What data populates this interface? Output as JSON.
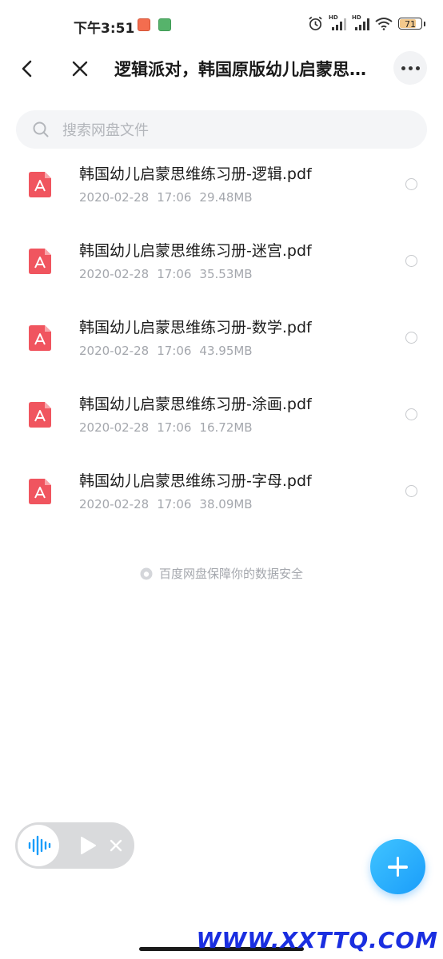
{
  "status_bar": {
    "time": "下午3:51",
    "network_label": "HD",
    "battery": "71",
    "icons": [
      "alarm-icon",
      "signal-icon",
      "signal-icon",
      "wifi-icon",
      "battery-icon"
    ]
  },
  "header": {
    "title": "逻辑派对，韩国原版幼儿启蒙思维练习册",
    "back_icon": "chevron-left-icon",
    "close_icon": "close-icon",
    "more_icon": "more-icon"
  },
  "search": {
    "placeholder": "搜索网盘文件"
  },
  "files": [
    {
      "name": "韩国幼儿启蒙思维练习册-逻辑.pdf",
      "date": "2020-02-28",
      "time": "17:06",
      "size": "29.48MB",
      "icon": "pdf-icon"
    },
    {
      "name": "韩国幼儿启蒙思维练习册-迷宫.pdf",
      "date": "2020-02-28",
      "time": "17:06",
      "size": "35.53MB",
      "icon": "pdf-icon"
    },
    {
      "name": "韩国幼儿启蒙思维练习册-数学.pdf",
      "date": "2020-02-28",
      "time": "17:06",
      "size": "43.95MB",
      "icon": "pdf-icon"
    },
    {
      "name": "韩国幼儿启蒙思维练习册-涂画.pdf",
      "date": "2020-02-28",
      "time": "17:06",
      "size": "16.72MB",
      "icon": "pdf-icon"
    },
    {
      "name": "韩国幼儿启蒙思维练习册-字母.pdf",
      "date": "2020-02-28",
      "time": "17:06",
      "size": "38.09MB",
      "icon": "pdf-icon"
    }
  ],
  "footer_note": "百度网盘保障你的数据安全",
  "watermark": "WWW.XXTTQ.COM",
  "colors": {
    "accent": "#1a9dfa",
    "pdf_red": "#f0555f",
    "meta_gray": "#a4a7ad"
  }
}
